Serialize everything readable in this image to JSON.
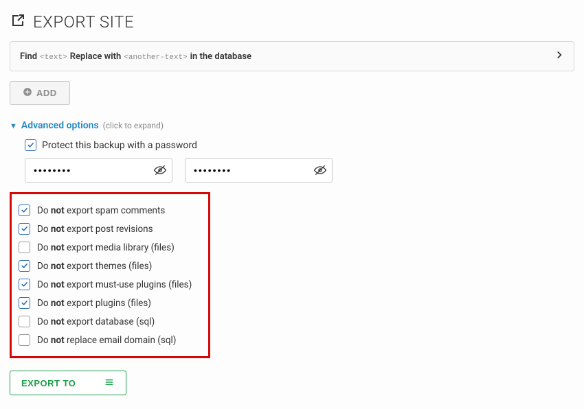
{
  "page": {
    "title": "EXPORT SITE"
  },
  "find_replace": {
    "find": "Find",
    "tag_find": "<text>",
    "replace": "Replace with",
    "tag_replace": "<another-text>",
    "suffix": "in the database"
  },
  "buttons": {
    "add": "ADD",
    "export_to": "EXPORT TO"
  },
  "advanced": {
    "title": "Advanced options",
    "hint": "(click to expand)",
    "protect_label": "Protect this backup with a password",
    "protect_checked": true,
    "password1": "••••••••",
    "password2": "••••••••"
  },
  "options": [
    {
      "checked": true,
      "pre": "Do ",
      "not": "not",
      "post": " export spam comments"
    },
    {
      "checked": true,
      "pre": "Do ",
      "not": "not",
      "post": " export post revisions"
    },
    {
      "checked": false,
      "pre": "Do ",
      "not": "not",
      "post": " export media library (files)"
    },
    {
      "checked": true,
      "pre": "Do ",
      "not": "not",
      "post": " export themes (files)"
    },
    {
      "checked": true,
      "pre": "Do ",
      "not": "not",
      "post": " export must-use plugins (files)"
    },
    {
      "checked": true,
      "pre": "Do ",
      "not": "not",
      "post": " export plugins (files)"
    },
    {
      "checked": false,
      "pre": "Do ",
      "not": "not",
      "post": " export database (sql)"
    },
    {
      "checked": false,
      "pre": "Do ",
      "not": "not",
      "post": " replace email domain (sql)"
    }
  ]
}
